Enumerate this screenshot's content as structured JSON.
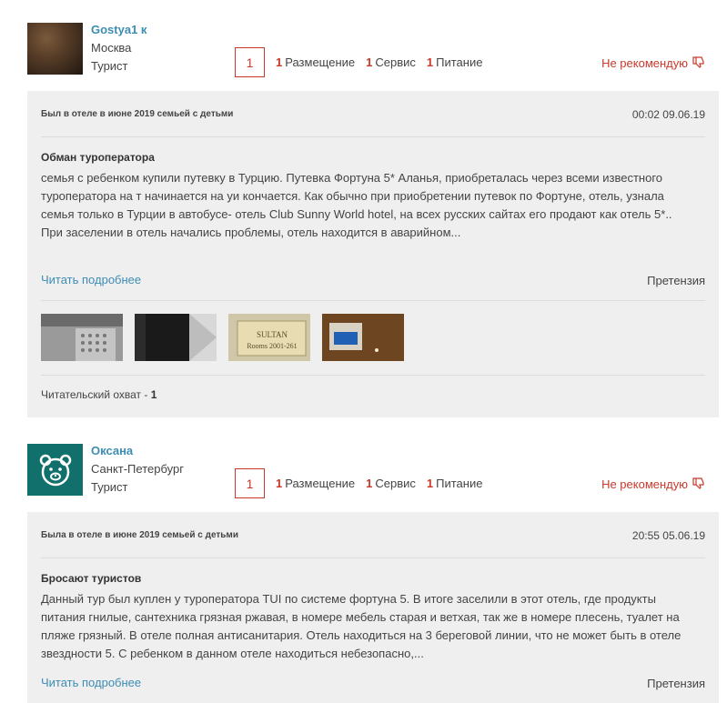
{
  "reviews": [
    {
      "user": {
        "name": "Gostya1 к",
        "city": "Москва",
        "role": "Турист",
        "avatar_icon": "cat-photo"
      },
      "score": "1",
      "ratings": [
        {
          "value": "1",
          "label": "Размещение"
        },
        {
          "value": "1",
          "label": "Сервис"
        },
        {
          "value": "1",
          "label": "Питание"
        }
      ],
      "recommendation": "Не рекомендую",
      "meta": "Был в отеле  в июне 2019 семьей с детьми",
      "time": "00:02 09.06.19",
      "title": "Обман туроператора",
      "text": "семья с ребенком купили путевку в Турцию. Путевка Фортуна 5* Аланья, приобреталась через всеми известного туроператора на т начинается на уи кончается. Как обычно при приобретении путевок по Фортуне, отель, узнала семья только в Турции в автобусе- отель Club Sunny World hotel, на всех русских сайтах его продают как отель 5*.. При заселении в отель начались проблемы, отель находится в аварийном...",
      "read_more": "Читать подробнее",
      "complaint": "Претензия",
      "photos": [
        {
          "label": "photo-drain"
        },
        {
          "label": "photo-dark-wall"
        },
        {
          "label": "photo-sign",
          "sign_line1": "SULTAN",
          "sign_line2": "Rooms 2001-261"
        },
        {
          "label": "photo-tv"
        }
      ],
      "reach_label": "Читательский охват - ",
      "reach_value": "1"
    },
    {
      "user": {
        "name": "Оксана",
        "city": "Санкт-Петербург",
        "role": "Турист",
        "avatar_icon": "bear-icon"
      },
      "score": "1",
      "ratings": [
        {
          "value": "1",
          "label": "Размещение"
        },
        {
          "value": "1",
          "label": "Сервис"
        },
        {
          "value": "1",
          "label": "Питание"
        }
      ],
      "recommendation": "Не рекомендую",
      "meta": "Была в отеле  в июне 2019 семьей с детьми",
      "time": "20:55 05.06.19",
      "title": "Бросают туристов",
      "text": "Данный тур был куплен у туроператора TUI по системе фортуна 5. В итоге заселили в этот отель, где продукты питания гнилые, сантехника грязная ржавая, в номере мебель старая и ветхая, так же в номере плесень, туалет на пляже грязный. В отеле полная антисанитария. Отель находиться на 3 береговой линии, что не может быть в отеле звездности 5. С ребенком в данном отеле находиться небезопасно,...",
      "read_more": "Читать подробнее",
      "complaint": "Претензия"
    }
  ]
}
